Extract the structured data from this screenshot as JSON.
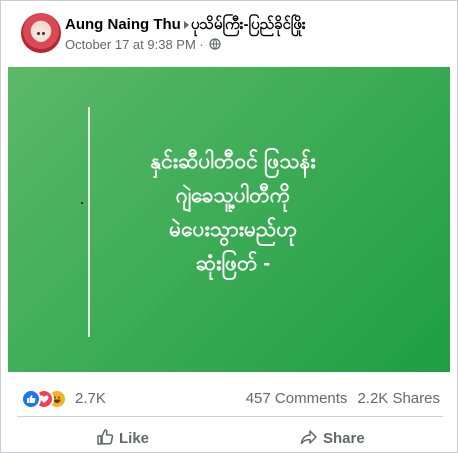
{
  "post": {
    "author": "Aung Naing Thu",
    "group": "ပုသိမ်ကြီး-ပြည်ခိုင်ဖြိုး",
    "timestamp": "October 17 at 9:38 PM",
    "separator": "·",
    "privacy_icon": "globe-icon"
  },
  "image": {
    "background_color": "#3fad57",
    "lines": [
      "နှင်းဆီပါတီဝင် ဖြသန်း",
      "ဂျဲခေသူ့ပါတီကို",
      "မဲပေးသွားမည်ဟု",
      "ဆုံးဖြတ် -"
    ]
  },
  "stats": {
    "reaction_icons": [
      "like-icon",
      "love-icon",
      "haha-icon"
    ],
    "reactions": "2.7K",
    "comments": "457 Comments",
    "shares": "2.2K Shares"
  },
  "actions": {
    "like": "Like",
    "share": "Share"
  }
}
